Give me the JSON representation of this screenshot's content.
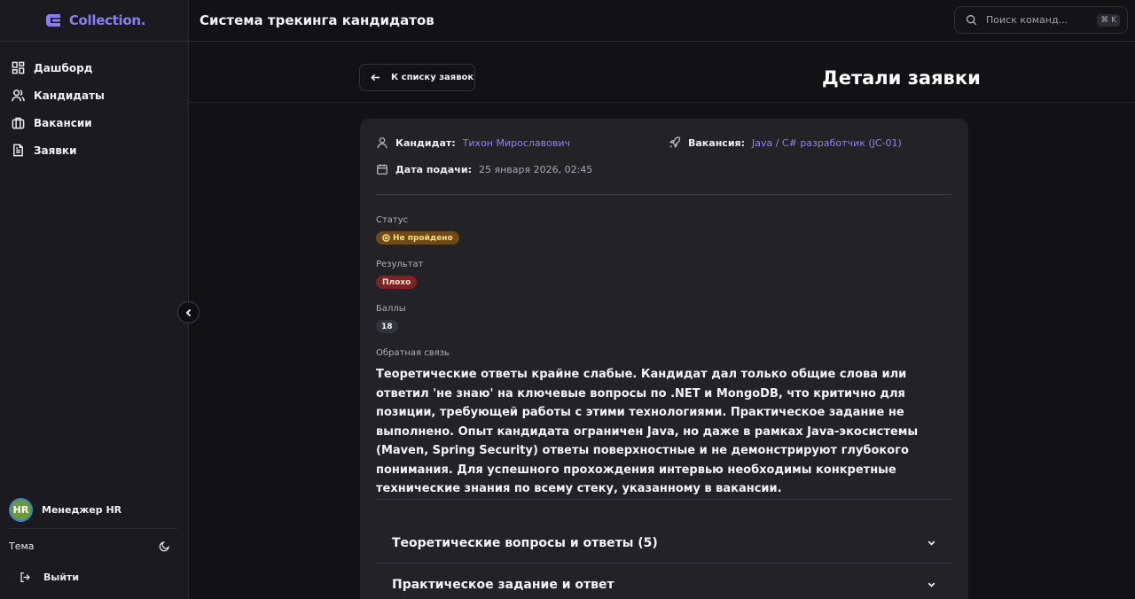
{
  "brand": {
    "name": "Collection.",
    "accent": "#8b7cf6"
  },
  "sidebar": {
    "items": [
      {
        "label": "Дашборд",
        "icon": "dashboard-icon"
      },
      {
        "label": "Кандидаты",
        "icon": "users-icon"
      },
      {
        "label": "Вакансии",
        "icon": "briefcase-icon"
      },
      {
        "label": "Заявки",
        "icon": "file-text-icon"
      }
    ],
    "user": {
      "initials": "HR",
      "name": "Менеджер HR"
    },
    "theme_label": "Тема",
    "logout_label": "Выйти"
  },
  "header": {
    "title": "Система трекинга кандидатов",
    "search_placeholder": "Поиск команд...",
    "search_shortcut": "⌘ K"
  },
  "page": {
    "back_label": "К списку заявок",
    "title": "Детали заявки"
  },
  "application": {
    "candidate_label": "Кандидат:",
    "candidate_name": "Тихон Мирославович",
    "vacancy_label": "Вакансия:",
    "vacancy_name": "Java / C# разработчик (JC-01)",
    "date_label": "Дата подачи:",
    "date_value": "25 января 2026, 02:45",
    "status_label": "Статус",
    "status_value": "Не пройдено",
    "result_label": "Результат",
    "result_value": "Плохо",
    "score_label": "Баллы",
    "score_value": "18",
    "feedback_label": "Обратная связь",
    "feedback_text": "Теоретические ответы крайне слабые. Кандидат дал только общие слова или ответил 'не знаю' на ключевые вопросы по .NET и MongoDB, что критично для позиции, требующей работы с этими технологиями. Практическое задание не выполнено. Опыт кандидата ограничен Java, но даже в рамках Java-экосистемы (Maven, Spring Security) ответы поверхностные и не демонстрируют глубокого понимания. Для успешного прохождения интервью необходимы конкретные технические знания по всему стеку, указанному в вакансии."
  },
  "sections": [
    {
      "title": "Теоретические вопросы и ответы (5)"
    },
    {
      "title": "Практическое задание и ответ"
    }
  ],
  "colors": {
    "status_bg": "#6e4a15",
    "result_bg": "#7a2424",
    "link": "#8f82f0"
  }
}
